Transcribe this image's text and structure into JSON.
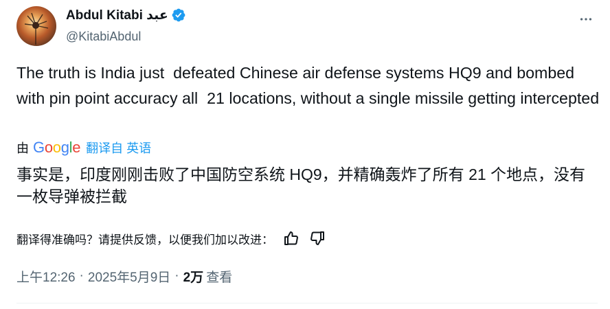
{
  "author": {
    "display_name": "Abdul Kitabi عبد",
    "handle": "@KitabiAbdul",
    "verified_icon": "verified-badge-icon",
    "avatar": "sunset-flower-avatar"
  },
  "tweet": {
    "text": "The truth is India just  defeated Chinese air defense systems HQ9 and bombed with pin point accuracy all  21 locations, without a single missile getting intercepted"
  },
  "translation": {
    "by_label": "由",
    "provider_logo": [
      "G",
      "o",
      "o",
      "g",
      "l",
      "e"
    ],
    "link_label": "翻译自 英语",
    "text": "事实是，印度刚刚击败了中国防空系统 HQ9，并精确轰炸了所有 21 个地点，没有一枚导弹被拦截",
    "feedback_prompt": "翻译得准确吗？请提供反馈，以便我们加以改进：",
    "thumbs_up_icon": "thumbs-up-icon",
    "thumbs_down_icon": "thumbs-down-icon"
  },
  "meta": {
    "time": "上午12:26",
    "separator": "·",
    "date": "2025年5月9日",
    "views_count": "2万",
    "views_label": "查看"
  },
  "colors": {
    "text_primary": "#0f1419",
    "text_secondary": "#536471",
    "link": "#1d9bf0",
    "verified": "#1d9bf0",
    "divider": "#eff3f4"
  },
  "more_icon": "more-options-icon"
}
